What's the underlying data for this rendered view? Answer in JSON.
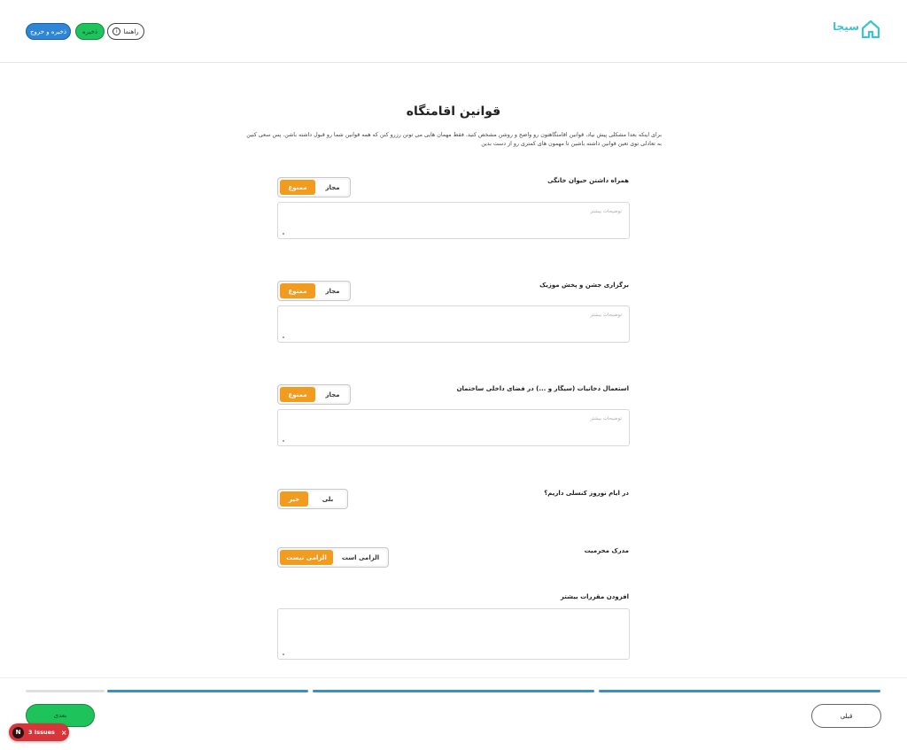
{
  "header": {
    "logo_text": "سیجا",
    "exit_label": "ذخیره و خروج",
    "save_label": "ذخیره",
    "help_label": "راهنما",
    "help_icon": "info-icon"
  },
  "main": {
    "title": "قوانین اقامتگاه",
    "intro": "برای اینکه بعدا مشکلی پیش نیاد، قوانین اقامتگاهتون رو واضح و روشن مشخص کنید. فقط مهمان هایی می تونن رزرو کنن که همه قوانین شما رو قبول داشته باشن. پس سعی کنین به تعادلی توی تعین قوانین داشته باشین تا مهمون های کمتری رو از دست بدین",
    "rules": [
      {
        "label": "همراه داشتن حیوان خانگی",
        "options": [
          "مجاز",
          "ممنوع"
        ],
        "selected": "ممنوع",
        "placeholder": "توضیحات بیشتر"
      },
      {
        "label": "برگزاری جشن و پخش موزیک",
        "options": [
          "مجاز",
          "ممنوع"
        ],
        "selected": "ممنوع",
        "placeholder": "توضیحات بیشتر"
      },
      {
        "label": "استعمال دخانیات (سیگار و ...) در فضای داخلی ساختمان",
        "options": [
          "مجاز",
          "ممنوع"
        ],
        "selected": "ممنوع",
        "placeholder": "توضیحات بیشتر"
      }
    ],
    "nowruz": {
      "label": "در ایام نوروز کنسلی داریم؟",
      "options": [
        "بلی",
        "خیر"
      ],
      "selected": "خیر"
    },
    "kinship": {
      "label": "مدرک محرمیت",
      "options": [
        "الزامی است",
        "الزامی نیست"
      ],
      "selected": "الزامی نیست"
    },
    "extra": {
      "label": "افزودن مقررات بیشتر"
    }
  },
  "footer": {
    "next_label": "بعدی",
    "prev_label": "قبلی",
    "progress_color": "#3a8fc9",
    "issues_badge": "N",
    "issues_label": "3 Issues",
    "issues_close": "×"
  }
}
